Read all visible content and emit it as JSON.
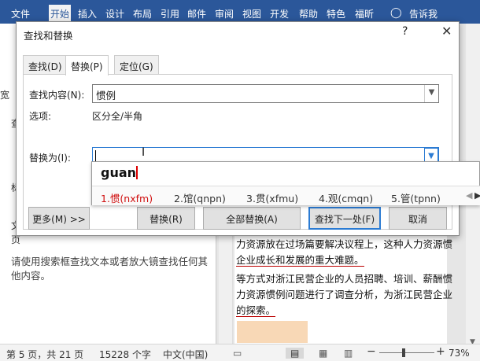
{
  "ribbon": {
    "tabs": [
      "文件",
      "开始",
      "插入",
      "设计",
      "布局",
      "引用",
      "邮件",
      "审阅",
      "视图",
      "开发",
      "帮助",
      "特色",
      "福昕",
      "告诉我"
    ],
    "active": "开始"
  },
  "nav_pane": {
    "partial_labels": [
      "宽",
      "查",
      "标",
      "文",
      "页"
    ],
    "hint": "请使用搜索框查找文本或者放大镜查找任何其他内容。"
  },
  "document": {
    "lines": [
      "力资源放在过场篇要解决议程上，这种人力资源惯",
      "企业成长和发展的重大难题。",
      "等方式对浙江民营企业的人员招聘、培训、薪酬惯",
      "力资源惯例问题进行了调查分析，为浙江民营企业",
      "的探索。"
    ]
  },
  "status_bar": {
    "page": "第 5 页，共 21 页",
    "words": "15228 个字",
    "language": "中文(中国)",
    "zoom": "73%",
    "minus": "−",
    "plus": "+"
  },
  "dialog": {
    "title": "查找和替换",
    "help": "?",
    "close": "✕",
    "tabs": [
      "查找(D)",
      "替换(P)",
      "定位(G)"
    ],
    "active_tab": "替换(P)",
    "find_label": "查找内容(N):",
    "find_value": "惯例",
    "options_label": "选项:",
    "options_value": "区分全/半角",
    "replace_label": "替换为(I):",
    "replace_value": "",
    "buttons": {
      "more": "更多(M) >>",
      "replace": "替换(R)",
      "replace_all": "全部替换(A)",
      "find_next": "查找下一处(F)",
      "cancel": "取消"
    }
  },
  "ime": {
    "composition": "guan",
    "candidates": [
      "1.惯(nxfm)",
      "2.馆(qnpn)",
      "3.贯(xfmu)",
      "4.观(cmqn)",
      "5.管(tpnn)"
    ],
    "prev": "◀",
    "next": "▶"
  },
  "colors": {
    "ribbon": "#2b579a",
    "selected_candidate": "#d01010",
    "focus": "#2b7bd3"
  }
}
